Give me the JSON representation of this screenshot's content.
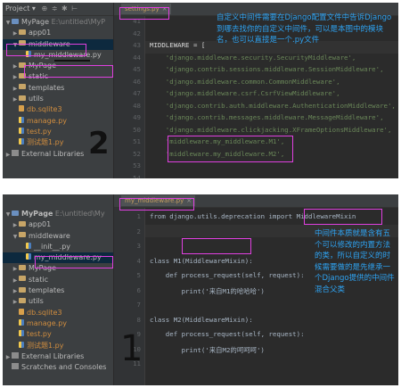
{
  "project_header": "Project",
  "panel1": {
    "tree": [
      {
        "label": "MyPage",
        "path": "E:\\untitled\\MyP",
        "type": "root",
        "arrow": "▼"
      },
      {
        "label": "app01",
        "type": "folder",
        "arrow": "▶"
      },
      {
        "label": "middleware",
        "type": "folder",
        "arrow": "▼"
      },
      {
        "label": "my_middleware.py",
        "type": "py",
        "arrow": ""
      },
      {
        "label": "MyPage",
        "type": "folder",
        "arrow": "▶"
      },
      {
        "label": "static",
        "type": "folder",
        "arrow": "▶"
      },
      {
        "label": "templates",
        "type": "folder",
        "arrow": "▶"
      },
      {
        "label": "utils",
        "type": "folder",
        "arrow": "▶"
      },
      {
        "label": "db.sqlite3",
        "type": "db",
        "arrow": ""
      },
      {
        "label": "manage.py",
        "type": "py",
        "arrow": ""
      },
      {
        "label": "test.py",
        "type": "py",
        "arrow": ""
      },
      {
        "label": "测试题1.py",
        "type": "py",
        "arrow": ""
      },
      {
        "label": "External Libraries",
        "type": "lib",
        "arrow": "▶"
      }
    ],
    "tab": "settings.py",
    "lines": [
      {
        "n": "41",
        "text": ""
      },
      {
        "n": "42",
        "text": ""
      },
      {
        "n": "43",
        "text": "MIDDLEWARE = ["
      },
      {
        "n": "44",
        "text": "    'django.middleware.security.SecurityMiddleware',"
      },
      {
        "n": "45",
        "text": "    'django.contrib.sessions.middleware.SessionMiddleware',"
      },
      {
        "n": "46",
        "text": "    'django.middleware.common.CommonMiddleware',"
      },
      {
        "n": "47",
        "text": "    'django.middleware.csrf.CsrfViewMiddleware',"
      },
      {
        "n": "48",
        "text": "    'django.contrib.auth.middleware.AuthenticationMiddleware',"
      },
      {
        "n": "49",
        "text": "    'django.contrib.messages.middleware.MessageMiddleware',"
      },
      {
        "n": "50",
        "text": "    'django.middleware.clickjacking.XFrameOptionsMiddleware',"
      },
      {
        "n": "51",
        "text": "    'middleware.my_middleware.M1',"
      },
      {
        "n": "52",
        "text": "    'middleware.my_middleware.M2',"
      },
      {
        "n": "53",
        "text": ""
      },
      {
        "n": "54",
        "text": ""
      }
    ],
    "note": "自定义中间件需要在Django配置文件中告诉Django到哪去找你的自定义中间件，可以是本图中的模块名，也可以直接是一个.py文件",
    "handwriting": "2"
  },
  "panel2": {
    "tree": [
      {
        "label": "MyPage",
        "path": "E:\\untitled\\My",
        "type": "root",
        "arrow": "▼"
      },
      {
        "label": "app01",
        "type": "folder",
        "arrow": "▶"
      },
      {
        "label": "middleware",
        "type": "folder",
        "arrow": "▼"
      },
      {
        "label": "__init__.py",
        "type": "py",
        "arrow": ""
      },
      {
        "label": "my_middleware.py",
        "type": "py",
        "arrow": ""
      },
      {
        "label": "MyPage",
        "type": "folder",
        "arrow": "▶"
      },
      {
        "label": "static",
        "type": "folder",
        "arrow": "▶"
      },
      {
        "label": "templates",
        "type": "folder",
        "arrow": "▶"
      },
      {
        "label": "utils",
        "type": "folder",
        "arrow": "▶"
      },
      {
        "label": "db.sqlite3",
        "type": "db",
        "arrow": ""
      },
      {
        "label": "manage.py",
        "type": "py",
        "arrow": ""
      },
      {
        "label": "test.py",
        "type": "py",
        "arrow": ""
      },
      {
        "label": "测试题1.py",
        "type": "py",
        "arrow": ""
      },
      {
        "label": "External Libraries",
        "type": "lib",
        "arrow": "▶"
      },
      {
        "label": "Scratches and Consoles",
        "type": "lib",
        "arrow": ""
      }
    ],
    "tab": "my_middleware.py",
    "lines": [
      {
        "n": "1",
        "text": "from django.utils.deprecation import MiddlewareMixin"
      },
      {
        "n": "2",
        "text": ""
      },
      {
        "n": "3",
        "text": ""
      },
      {
        "n": "4",
        "text": "class M1(MiddlewareMixin):"
      },
      {
        "n": "5",
        "text": "    def process_request(self, request):"
      },
      {
        "n": "6",
        "text": "        print('来自M1的哈哈哈')"
      },
      {
        "n": "7",
        "text": ""
      },
      {
        "n": "8",
        "text": "class M2(MiddlewareMixin):"
      },
      {
        "n": "9",
        "text": "    def process_request(self, request):"
      },
      {
        "n": "10",
        "text": "        print('来自M2的呵呵呵')"
      },
      {
        "n": "11",
        "text": ""
      }
    ],
    "note": "中间件本质就是含有五个可以修改的内置方法的类，所以自定义的时候需要做的是先继承一个Django提供的中间件混合父类",
    "handwriting": "1"
  }
}
